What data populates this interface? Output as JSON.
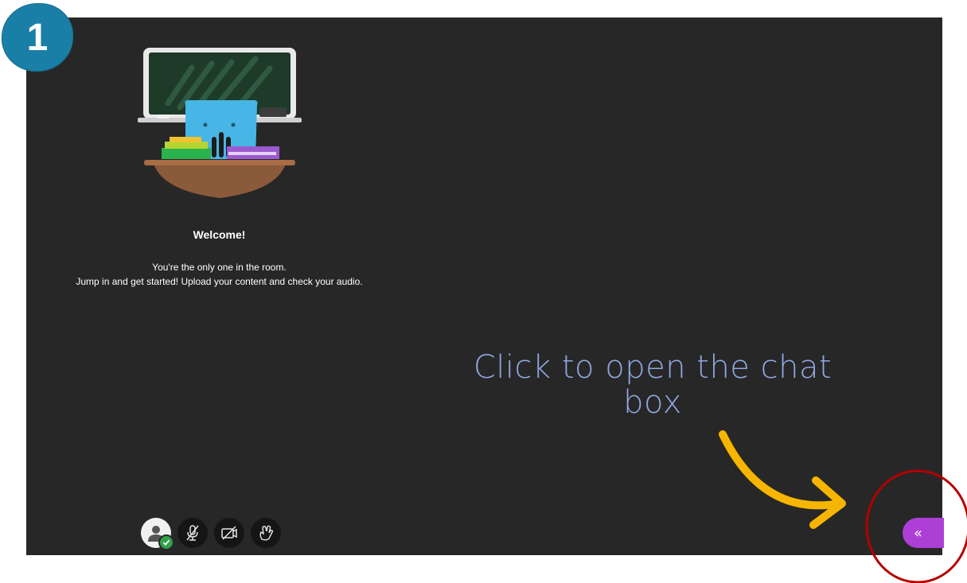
{
  "step": {
    "number": "1"
  },
  "welcome": {
    "title": "Welcome!",
    "line1": "You're the only one in the room.",
    "line2": "Jump in and get started! Upload your content and check your audio."
  },
  "annotation": {
    "hint_line1": "Click to open the chat",
    "hint_line2": "box",
    "arrow_color": "#f6b500",
    "circle_color": "#b30000",
    "hint_color": "#8fa8e0"
  },
  "toolbar": {
    "items": [
      {
        "icon": "user-avatar-icon",
        "status": "check-icon"
      },
      {
        "icon": "microphone-muted-icon"
      },
      {
        "icon": "camera-off-icon"
      },
      {
        "icon": "raise-hand-icon"
      }
    ]
  },
  "chat_toggle": {
    "glyph": "«",
    "color": "#ad3fd6"
  },
  "colors": {
    "stage": "#272727",
    "badge": "#1a7fa6"
  }
}
